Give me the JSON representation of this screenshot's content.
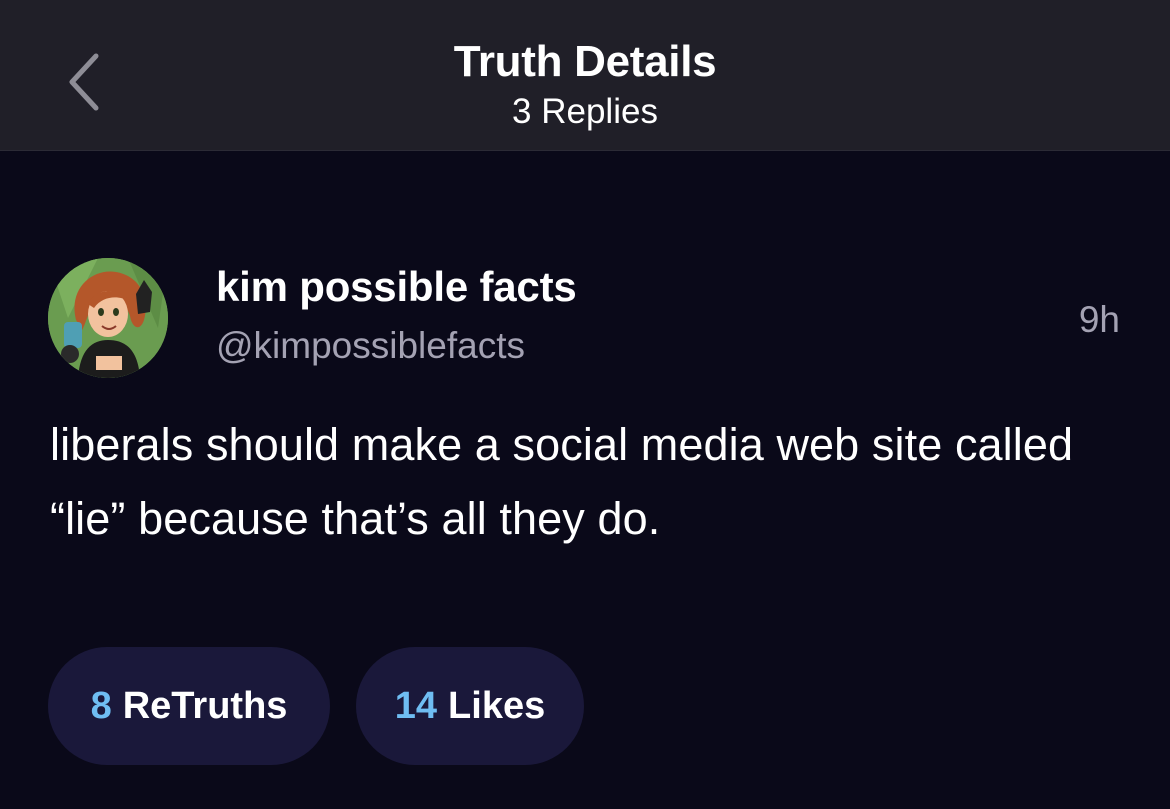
{
  "header": {
    "title": "Truth Details",
    "subtitle": "3 Replies",
    "back_icon": "chevron-left-icon"
  },
  "post": {
    "author": {
      "display_name": "kim possible facts",
      "handle": "@kimpossiblefacts",
      "avatar_icon": "cartoon-avatar"
    },
    "time": "9h",
    "text": "liberals should make a social media web site called “lie” because that’s all they do."
  },
  "stats": {
    "retruths": {
      "count": "8",
      "label": "ReTruths"
    },
    "likes": {
      "count": "14",
      "label": "Likes"
    }
  },
  "colors": {
    "background": "#0a0919",
    "header_bg": "#201f28",
    "pill_bg": "#1a183a",
    "accent": "#6fbdf2",
    "muted_text": "#a4a2b3"
  }
}
